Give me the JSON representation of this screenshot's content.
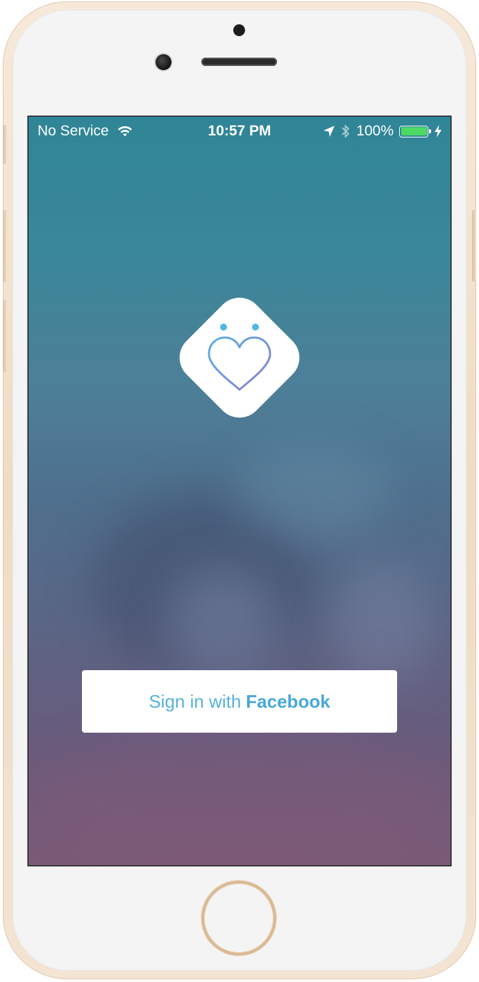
{
  "status_bar": {
    "carrier": "No Service",
    "time": "10:57 PM",
    "battery_percent": "100%",
    "battery_level": 1.0,
    "icons": [
      "wifi-icon",
      "location-arrow-icon",
      "bluetooth-icon",
      "battery-icon",
      "charging-bolt-icon"
    ]
  },
  "logo": {
    "icon": "heart-face-logo",
    "accent_color": "#4fb8e8",
    "heart_gradient": [
      "#5ab0e0",
      "#8a7fd0"
    ]
  },
  "login": {
    "prefix": "Sign in with",
    "brand": "Facebook",
    "text_color": "#56b2dc"
  },
  "device": {
    "icons": [
      "front-camera-icon",
      "speaker-grille",
      "home-button"
    ]
  }
}
